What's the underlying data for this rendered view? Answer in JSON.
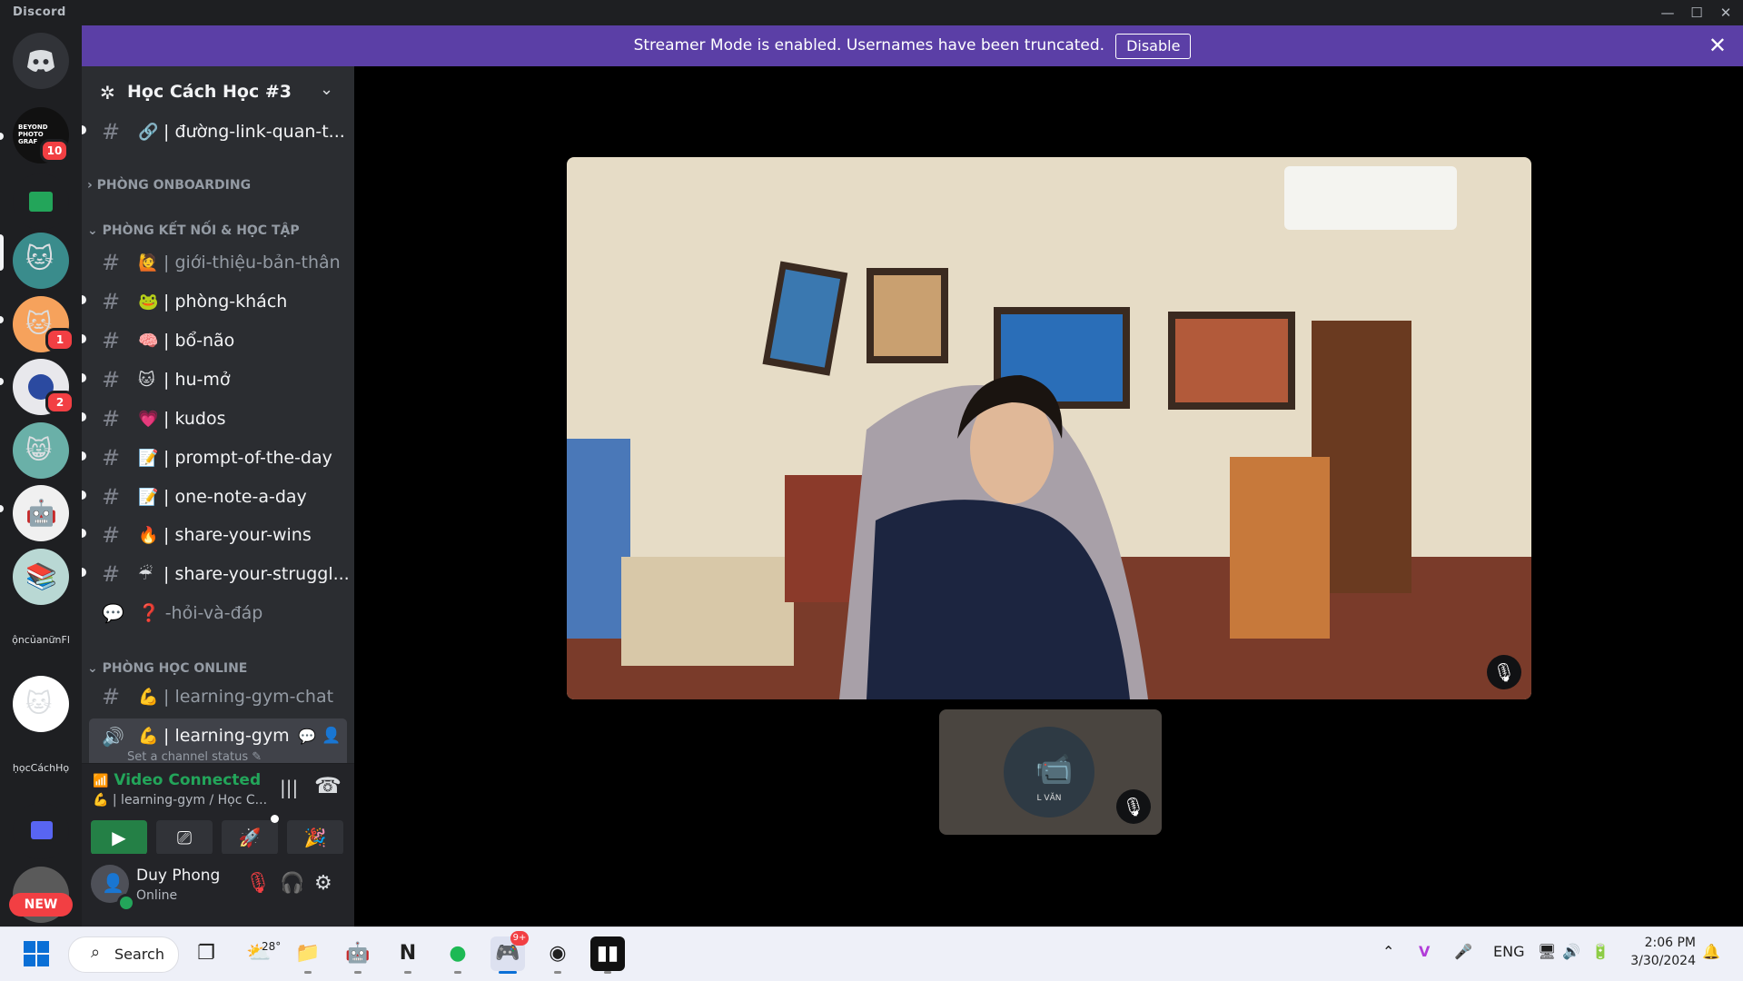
{
  "window": {
    "app_name": "Discord",
    "controls": [
      "—",
      "☐",
      "✕"
    ]
  },
  "banner": {
    "message": "Streamer Mode is enabled. Usernames have been truncated.",
    "button": "Disable",
    "close": "✕"
  },
  "rail": {
    "badges": {
      "beyond": "10",
      "wotn": "1",
      "blue": "2",
      "new": "NEW"
    },
    "text_servers": [
      "ộncủanữnFl",
      "ḥọcCáchHọ"
    ],
    "beyond_logo": "BEYOND PHOTO GRAF"
  },
  "guild": {
    "name": "Học Cách Học #3"
  },
  "channels": {
    "top": {
      "emoji": "🔗",
      "label": "| đường-link-quan-t..."
    },
    "cat_onboarding": "PHÒNG ONBOARDING",
    "cat_connect": "PHÒNG KẾT NỐI & HỌC TẬP",
    "list": [
      {
        "emoji": "🙋",
        "label": "| giới-thiệu-bản-thân",
        "muted": true
      },
      {
        "emoji": "🐸",
        "label": "| phòng-khách",
        "muted": false
      },
      {
        "emoji": "🧠",
        "label": "| bổ-não",
        "muted": false
      },
      {
        "emoji": "🐱",
        "label": "| hu-mở",
        "muted": false
      },
      {
        "emoji": "💗",
        "label": "| kudos",
        "muted": false
      },
      {
        "emoji": "📝",
        "label": "| prompt-of-the-day",
        "muted": false
      },
      {
        "emoji": "📝",
        "label": "| one-note-a-day",
        "muted": false
      },
      {
        "emoji": "🔥",
        "label": "| share-your-wins",
        "muted": false
      },
      {
        "emoji": "☔",
        "label": "| share-your-struggl...",
        "muted": false
      }
    ],
    "forum": {
      "label": "❓ -hỏi-và-đáp"
    },
    "cat_online": "PHÒNG HỌC ONLINE",
    "gym_chat": {
      "emoji": "💪",
      "label": "| learning-gym-chat"
    },
    "gym_voice": {
      "emoji": "💪",
      "label": "| learning-gym",
      "status": "Set a channel status"
    }
  },
  "voice": {
    "title": "Video Connected",
    "subtitle": "| learning-gym / Học C...",
    "emoji": "💪"
  },
  "user": {
    "name": "Duy Phong",
    "status": "Online"
  },
  "tile": {
    "name_tag": "L VĂN"
  },
  "taskbar": {
    "search": "Search",
    "weather": "28°",
    "discord_badge": "9+",
    "lang": "ENG",
    "time": "2:06 PM",
    "date": "3/30/2024"
  }
}
